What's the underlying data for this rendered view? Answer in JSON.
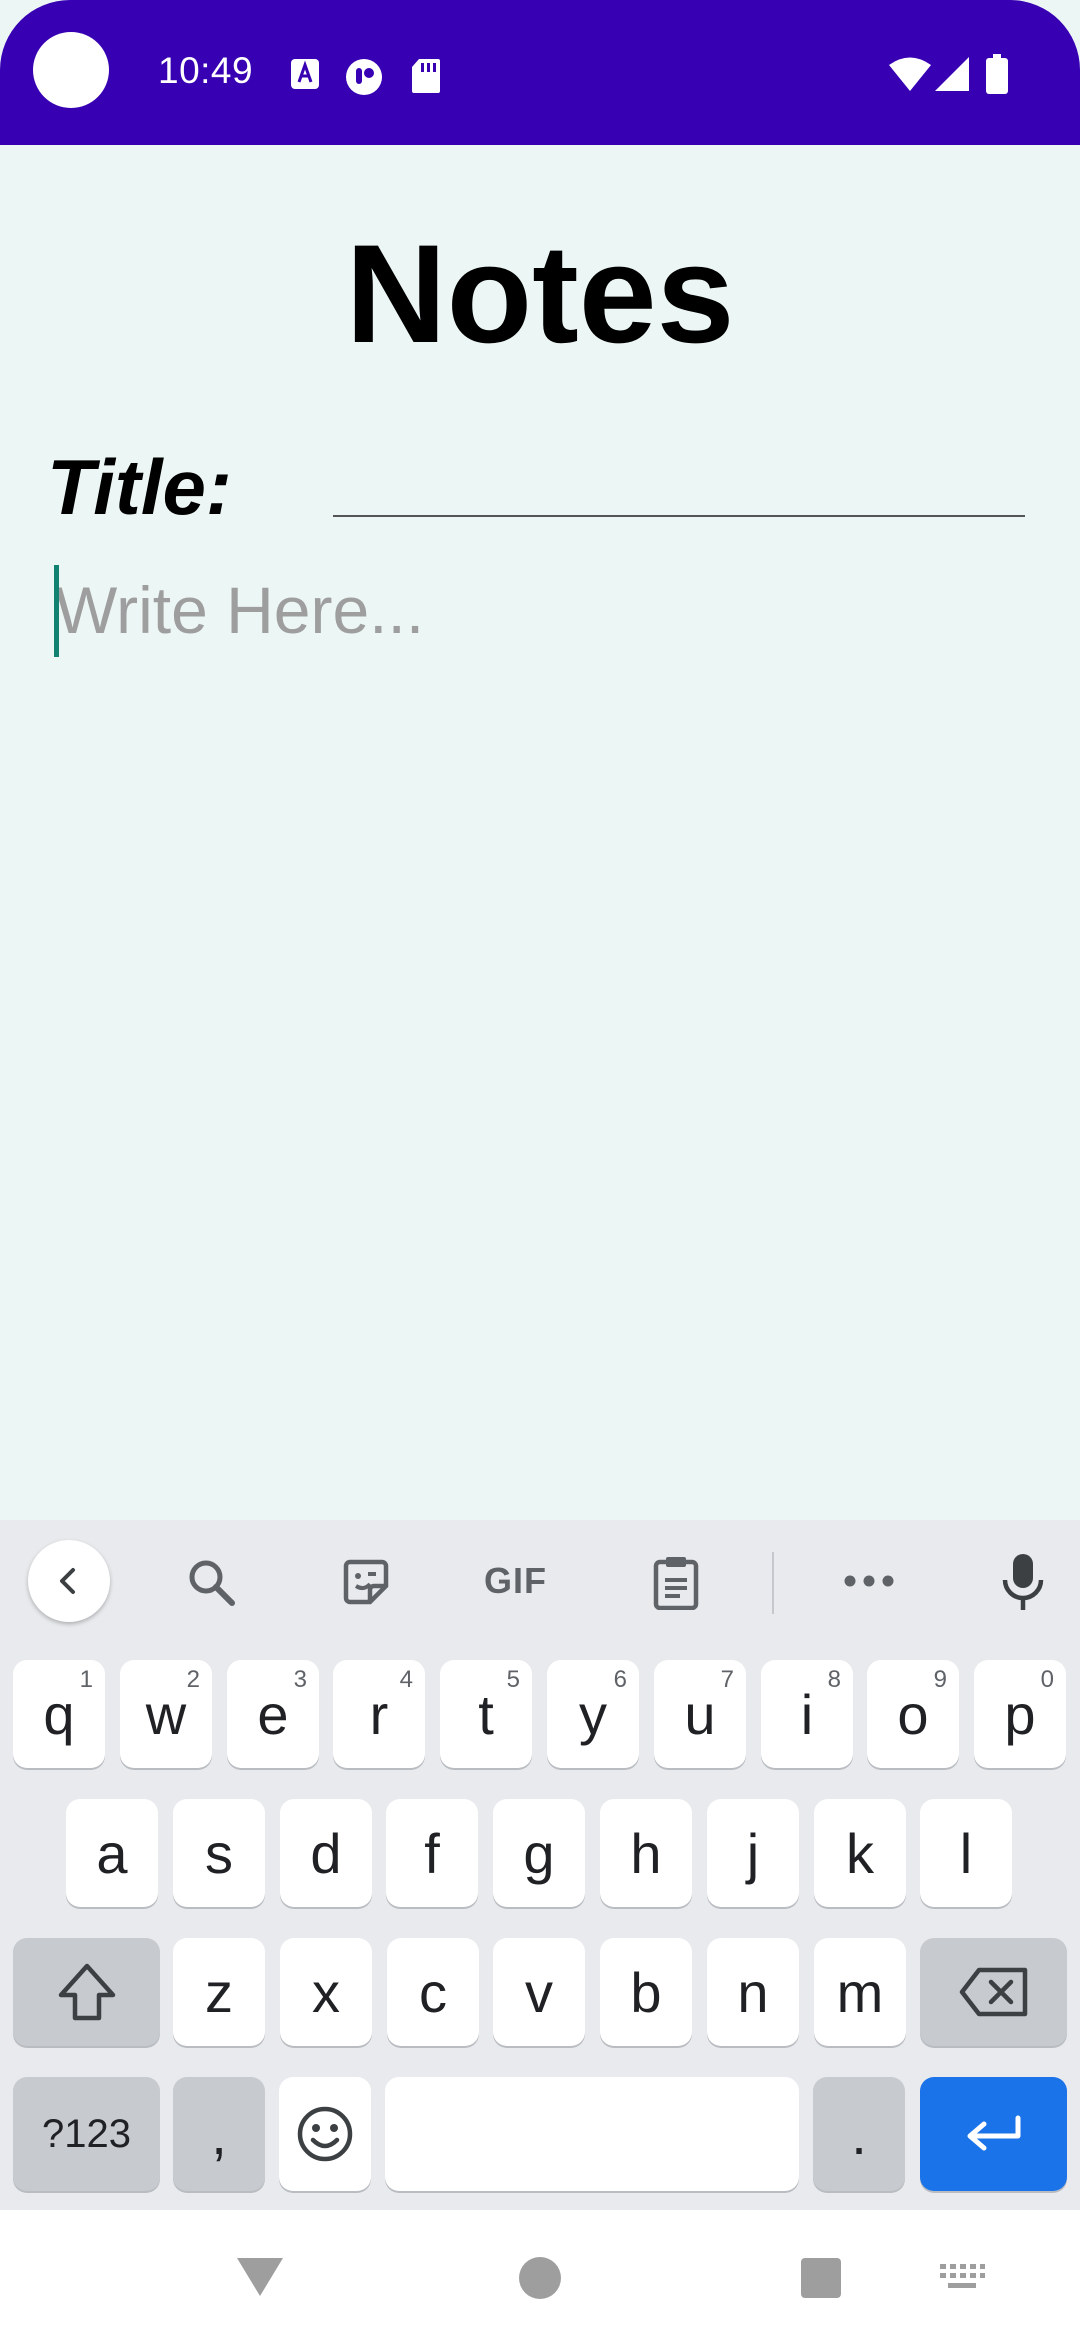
{
  "status_bar": {
    "time": "10:49",
    "icons": [
      "camera-cutout",
      "text-a-icon",
      "app-icon",
      "sd-card-icon",
      "wifi-icon",
      "cellular-icon",
      "battery-icon"
    ],
    "color": "#3700b3"
  },
  "app": {
    "title": "Notes",
    "title_label": "Title:",
    "title_value": "",
    "body_placeholder": "Write Here...",
    "body_value": "",
    "background": "#ecf6f5"
  },
  "keyboard": {
    "toolbar": [
      "back-icon",
      "search-icon",
      "sticker-icon",
      "gif-icon",
      "clipboard-icon",
      "more-icon",
      "mic-icon"
    ],
    "gif_label": "GIF",
    "row1": [
      {
        "key": "q",
        "hint": "1"
      },
      {
        "key": "w",
        "hint": "2"
      },
      {
        "key": "e",
        "hint": "3"
      },
      {
        "key": "r",
        "hint": "4"
      },
      {
        "key": "t",
        "hint": "5"
      },
      {
        "key": "y",
        "hint": "6"
      },
      {
        "key": "u",
        "hint": "7"
      },
      {
        "key": "i",
        "hint": "8"
      },
      {
        "key": "o",
        "hint": "9"
      },
      {
        "key": "p",
        "hint": "0"
      }
    ],
    "row2": [
      "a",
      "s",
      "d",
      "f",
      "g",
      "h",
      "j",
      "k",
      "l"
    ],
    "row3": [
      "z",
      "x",
      "c",
      "v",
      "b",
      "n",
      "m"
    ],
    "symbols_label": "?123",
    "comma": ",",
    "period": ".",
    "accent": "#1a73e8"
  },
  "nav_bar": {
    "buttons": [
      "back-triangle",
      "home-circle",
      "recents-square",
      "keyboard-switch-icon"
    ]
  }
}
